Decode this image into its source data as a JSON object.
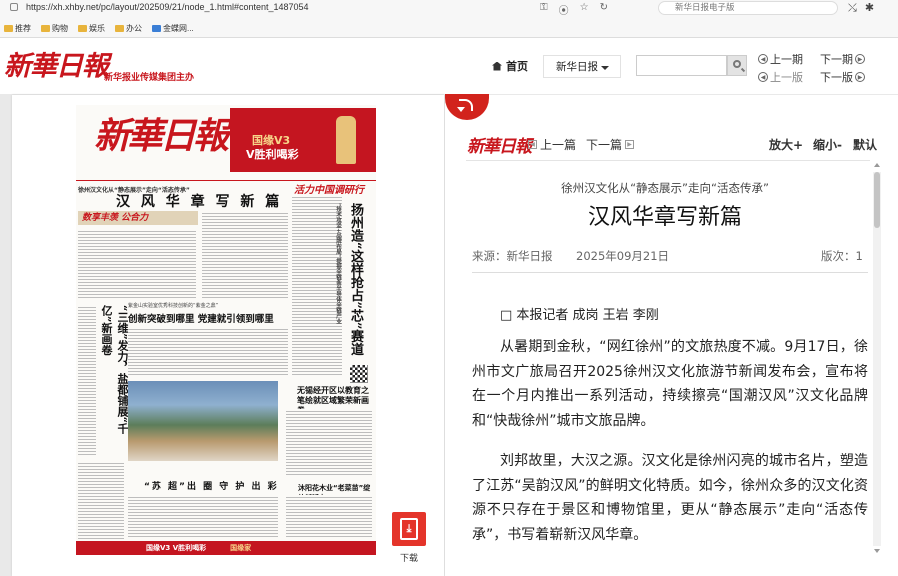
{
  "browser": {
    "url": "https://xh.xhby.net/pc/layout/202509/21/node_1.html#content_1487054",
    "search_text": "新华日报电子版",
    "bookmarks": [
      "推荐",
      "购物",
      "娱乐",
      "办公",
      "金蝶网..."
    ]
  },
  "header": {
    "logo": "新華日報",
    "group_text": "新华报业传媒集团主办",
    "home_label": "首页",
    "paper_select": "新华日报",
    "search_placeholder": "",
    "prev_page": "上一期",
    "next_page": "下一期",
    "prev_layout": "上一版",
    "next_layout": "下一版"
  },
  "newspaper": {
    "masthead": "新華日報",
    "ad_line1": "国缘V3",
    "ad_line2": "V胜利喝彩",
    "lead_kicker": "徐州汉文化从“静态展示”走向“活态传承”",
    "lead_title": "汉 风 华 章 写 新 篇",
    "column_banner": "活力中国调研行",
    "red_band": "数享丰羡 公合力",
    "vtitle_left": "“三维”发力，盐都铺展“千亿”新画卷",
    "vtitle_right": "扬州造“这样抢占”芯”赛道",
    "vtitle_right_kicker": "“技术攻坚+品牌布局”提振全链条半导体全链产业",
    "mid_kicker": "紫金山实验室优秀科技创新的“紫金之鼎”",
    "mid_title": "创新突破到哪里 党建就引领到哪里",
    "right_headline": "无锡经开区以教育之笔绘就区域繁荣新画卷",
    "bottom_title": "“苏 超”出 圈  守 护 出 彩",
    "bottom_right": "沐阳花木业“老菜苗”绽放新活力",
    "footer_ad": "国缘V3 V胜利喝彩",
    "footer_ad2": "国缘家"
  },
  "download": {
    "label": "下载"
  },
  "article": {
    "logo": "新華日報",
    "prev": "上一篇",
    "next": "下一篇",
    "zoom_in": "放大+",
    "zoom_out": "缩小-",
    "default": "默认",
    "subtitle": "徐州汉文化从“静态展示”走向“活态传承”",
    "title": "汉风华章写新篇",
    "source": "来源：新华日报",
    "date": "2025年09月21日",
    "edition": "版次：1",
    "byline": "□ 本报记者 成岗 王岩 李刚",
    "p1": "从暑期到金秋，“网红徐州”的文旅热度不减。9月17日，徐州市文广旅局召开2025徐州汉文化旅游节新闻发布会，宣布将在一个月内推出一系列活动，持续擦亮“国潮汉风”汉文化品牌和“快哉徐州”城市文旅品牌。",
    "p2": "刘邦故里，大汉之源。汉文化是徐州闪亮的城市名片，塑造了江苏“吴韵汉风”的鲜明文化特质。如今，徐州众多的汉文化资源不只存在于景区和博物馆里，更从“静态展示”走向“活态传承”，书写着崭新汉风华章。"
  },
  "colors": {
    "brand_red": "#c8161d",
    "accent_red": "#d2231c"
  }
}
